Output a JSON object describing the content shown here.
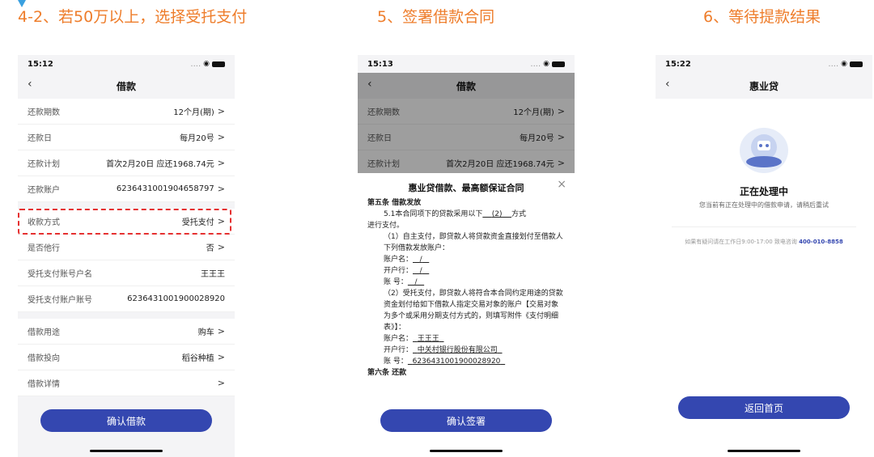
{
  "steps": [
    {
      "title": "4-2、若50万以上，选择受托支付"
    },
    {
      "title": "5、签署借款合同"
    },
    {
      "title": "6、等待提款结果"
    }
  ],
  "screen1": {
    "time": "15:12",
    "nav_title": "借款",
    "group1": [
      {
        "label": "还款期数",
        "value": "12个月(期)",
        "chev": ">"
      },
      {
        "label": "还款日",
        "value": "每月20号",
        "chev": ">"
      },
      {
        "label": "还款计划",
        "value": "首次2月20日 应还1968.74元",
        "chev": ">"
      },
      {
        "label": "还款账户",
        "value": "6236431001904658797",
        "chev": ">"
      }
    ],
    "group2": [
      {
        "label": "收款方式",
        "value": "受托支付",
        "chev": ">"
      },
      {
        "label": "是否他行",
        "value": "否",
        "chev": ">"
      },
      {
        "label": "受托支付账号户名",
        "value": "王王王",
        "chev": ""
      },
      {
        "label": "受托支付账户账号",
        "value": "6236431001900028920",
        "chev": ""
      }
    ],
    "group3": [
      {
        "label": "借款用途",
        "value": "购车",
        "chev": ">"
      },
      {
        "label": "借款投向",
        "value": "稻谷种植",
        "chev": ">"
      },
      {
        "label": "借款详情",
        "value": "",
        "chev": ">"
      }
    ],
    "button": "确认借款"
  },
  "screen2": {
    "time": "15:13",
    "nav_title": "借款",
    "bg_rows": [
      {
        "label": "还款期数",
        "value": "12个月(期)",
        "chev": ">"
      },
      {
        "label": "还款日",
        "value": "每月20号",
        "chev": ">"
      },
      {
        "label": "还款计划",
        "value": "首次2月20日 应还1968.74元",
        "chev": ">"
      }
    ],
    "sheet_title": "惠业贷借款、最高额保证合同",
    "close": "×",
    "contract": {
      "article5": "第五条 借款发放",
      "p1a": "5.1本合同项下的贷款采用以下",
      "p1b": "(2)",
      "p1c": "方式",
      "p1d": "进行支付。",
      "p2": "（1）自主支付，即贷款人将贷款资金直接划付至借款人下列借款发放账户：",
      "acct_name_label": "账户名：",
      "acct_bank_label": "开户行：",
      "acct_no_label": "账  号：",
      "slash": "/",
      "p3": "（2）受托支付，即贷款人将符合本合同约定用途的贷款资金划付给如下借款人指定交易对象的账户【交易对象为多个或采用分期支付方式的，则填写附件《支付明细表》】：",
      "t_name_label": "账户名：",
      "t_name": "王王王",
      "t_bank_label": "开户行：",
      "t_bank": "中关村银行股份有限公司",
      "t_no_label": "账  号：",
      "t_no": "6236431001900028920",
      "article6": "第六条 还款"
    },
    "button": "确认签署"
  },
  "screen3": {
    "time": "15:22",
    "nav_title": "惠业贷",
    "status_title": "正在处理中",
    "status_sub": "您当前有正在处理中的借款申请，请稍后重试",
    "note": "如果有疑问请在工作日9:00-17:00 致电咨询",
    "phone": "400-010-8858",
    "button": "返回首页"
  }
}
